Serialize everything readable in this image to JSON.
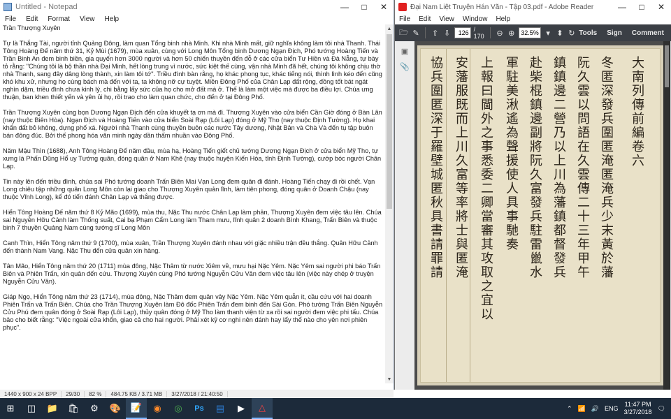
{
  "notepad": {
    "title": "Untitled - Notepad",
    "menu": [
      "File",
      "Edit",
      "Format",
      "View",
      "Help"
    ],
    "paragraphs": [
      "Trần Thượng Xuyên",
      "Tự là Thắng Tài, người tỉnh Quảng Đông, làm quan Tổng binh nhà Minh. Khi nhà Minh mất, giữ nghĩa không làm tôi nhà Thanh. Thái Tông Hoàng Đế năm thứ 31, Kỷ Mùi (1679), mùa xuân, cùng với Long Môn Tổng binh Dương Ngạn Địch, Phó tướng Hoàng Tiến và Trần Binh An đem binh biền, gia quyến hơn 3000 người và hơn 50 chiến thuyền đến đỗ ở các cửa biển Tư Hiền và Đà Nẵng, tự bày tỏ rằng: \"Chúng tôi là bộ thần nhà Đại Minh, hết lòng trung vì nước, sức kiệt thế cùng, vận nhà Minh đã hết, chúng tôi không chịu thờ nhà Thanh, sang đây dâng lòng thành, xin làm tôi tớ\". Triều đình bàn rằng, họ khác phong tục, khác tiếng nói, thình lình kéo đến cũng khó khu xử, nhưng họ cùng bách mà đến với ta, ta không nỡ cự tuyệt. Miền Đông Phố của Chân Lạp đất rộng, đồng tốt bát ngát nghìn dặm, triều đình chưa kinh lý, chi bằng lấy sức của họ cho mở đất mà ở. Thế là làm một việc mà được ba điều lợi. Chúa ưng thuận, ban khen thiết yến và yên ủi họ, rồi trao cho làm quan chức, cho đến ở tại Đông Phố.",
      "Trần Thượng Xuyên cùng bọn Dương Ngạn Địch đến cửa khuyết tạ ơn mà đi. Thượng Xuyên vào cửa biển Cần Giờ đóng ở Bàn Lân (nay thuộc Biên Hòa). Ngạn Địch và Hoàng Tiến vào cửa biển Soài Rạp (Lôi Lạp) đóng ở Mỹ Tho (nay thuộc Định Tường). Họ khai khẩn đất bỏ không, dựng phố xá. Người nhà Thanh cùng thuyền buôn các nước Tây dương, Nhật Bản và Chà Và đến tụ tập buôn bán đông đúc. Bởi thế phong hóa văn minh ngày dần thấm nhuần vào Đông Phố.",
      "Năm Mậu Thìn (1688), Anh Tông Hoàng Đế năm đầu, mùa hạ, Hoàng Tiến giết chủ tướng Dương Ngạn Địch ở cửa biển Mỹ Tho, tự xưng là Phấn Dũng Hổ uy Tướng quân, đóng quân ở Nam Khê (nay thuộc huyện Kiến Hòa, tỉnh Định Tường), cướp bóc người Chân Lạp.",
      "Tin này lên đến triều đình, chúa sai Phó tướng doanh Trấn Biên Mai Vạn Long đem quân đi đánh. Hoàng Tiến chạy đi rồi chết. Vạn Long chiêu tập những quân Long Môn còn lại giao cho Thượng Xuyên quản lĩnh, làm tiên phong, đóng quân ở Doanh Chậu (nay thuộc Vĩnh Long), kể đó tiến đánh Chân Lạp và thắng được.",
      "Hiển Tông Hoàng Đế năm thứ 8 Kỷ Mão (1699), mùa thu, Nặc Thu nước Chân Lạp làm phản, Thượng Xuyên đem việc tâu lên. Chúa sai Nguyễn Hữu Cảnh làm Thống suất, Cai bạ Phạm Cẩm Long làm Tham mưu, lĩnh quân 2 doanh Bình Khang, Trấn Biên và thuộc binh 7 thuyền Quảng Nam cùng tướng sĩ Long Môn",
      "Canh Thìn, Hiển Tông năm thứ 9 (1700), mùa xuân, Trần Thượng Xuyên đánh nhau với giặc nhiều trận đều thắng. Quân Hữu Cảnh đến thành Nam Vang. Nặc Thu đến cửa quân xin hàng.",
      "Tân Mão, Hiển Tông năm thứ 20 (1711) mùa đông, Nặc Thâm từ nước Xiêm về, mưu hại Nặc Yêm. Nặc Yêm sai người phi báo Trấn Biên và Phiên Trấn, xin quân đến cứu. Thượng Xuyên cùng Phó tướng Nguyễn Cửu Vân đem việc tâu lên (việc này chép ở truyện Nguyễn Cửu Vân).",
      "Giáp Ngọ, Hiển Tông năm thứ 23 (1714), mùa đông, Nặc Thâm đem quân vây Nặc Yêm. Nặc Yêm quẫn it, cầu cứu với hai doanh Phiên Trấn và Trấn Biên. Chúa cho Trần Thượng Xuyên làm Đô đốc Phiên Trấn đem binh đến Sài Gòn. Phó tướng Trấn Biên Nguyễn Cửu Phú đem quân đóng ở Soài Rạp (Lôi Lạp), thủy quân đóng ở Mỹ Tho làm thanh viện từ xa rồi sai người đem việc phi tấu. Chúa bảo cho biết rằng: \"Việc ngoài cửa khổn, giao cả cho hai người. Phải xét kỹ cơ nghi nên đánh hay lấy thế nào cho yên nơi phiên phục\"."
    ],
    "status": [
      "1440 x 900 x 24 BPP",
      "29/30",
      "82 %",
      "484.75 KB / 3.71 MB",
      "3/27/2018 / 21:40:50"
    ]
  },
  "reader": {
    "title": "Đại Nam Liệt Truyện Hán Văn - Tập 03.pdf - Adobe Reader",
    "menu": [
      "File",
      "Edit",
      "View",
      "Window",
      "Help"
    ],
    "page_current": "126",
    "page_total": "/ 170",
    "zoom": "32.5%",
    "right_buttons": [
      "Tools",
      "Sign",
      "Comment"
    ],
    "columns": [
      "大南列傳前編卷六",
      "冬匿深發兵圍匿淹匿淹兵少末黃於藩",
      "阮久雲以問語在久雲傳二十三年甲午",
      "鎮鎮邊二營乃以上川為藩鎮都督發兵",
      "赴柴棍鎮邊副將阮久富發兵駐雷巤水",
      "軍駐美湫遙為聲援使人具事馳奏",
      "上報曰閫外之事悉委二卿當審其攻取之宜以",
      "安藩服既而上川久富等率將士與匿淹",
      "協兵圍匿深于羅壁城匿秋具書請罪請"
    ]
  },
  "taskbar": {
    "language": "ENG",
    "time": "11:47 PM",
    "date": "3/27/2018"
  }
}
